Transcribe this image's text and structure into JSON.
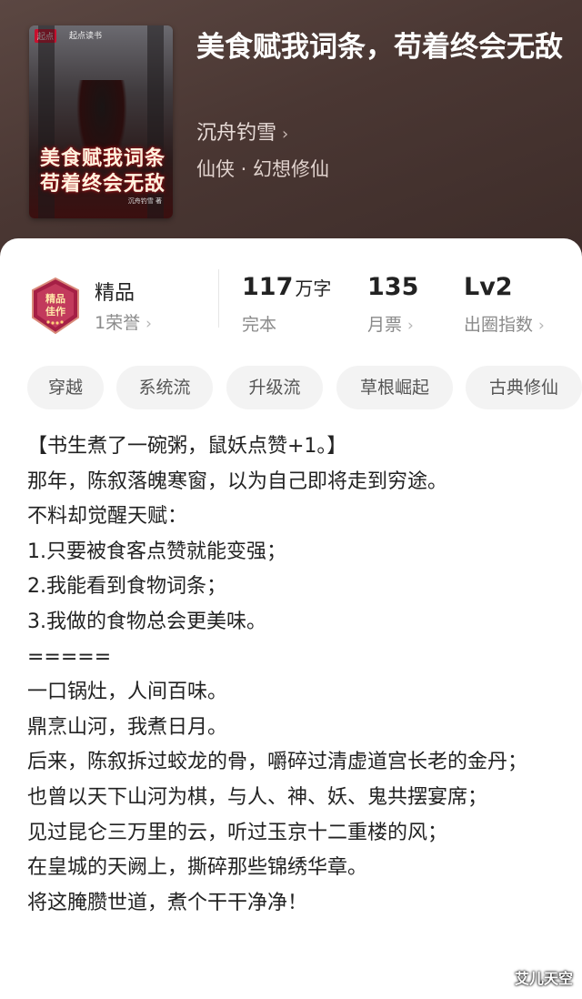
{
  "book": {
    "title": "美食赋我词条，苟着终会无敌",
    "author": "沉舟钓雪",
    "author_chevron": "›",
    "genre": "仙侠 · 幻想修仙",
    "cover": {
      "brand_badge": "起点",
      "brand_text": "起点读书",
      "title_line1": "美食赋我词条",
      "title_line2": "苟着终会无敌",
      "author_mini": "沉舟钓雪 著"
    }
  },
  "stats": {
    "badge_text": "精品",
    "badge_seal": "精品\n佳作",
    "honor": "1荣誉",
    "words_value": "117",
    "words_unit": "万字",
    "words_status": "完本",
    "monthly_value": "135",
    "monthly_label": "月票",
    "level_value": "Lv2",
    "level_label": "出圈指数",
    "chevron": "›"
  },
  "tags": [
    "穿越",
    "系统流",
    "升级流",
    "草根崛起",
    "古典修仙"
  ],
  "description": [
    "【书生煮了一碗粥，鼠妖点赞+1。】",
    "那年，陈叙落魄寒窗，以为自己即将走到穷途。",
    "不料却觉醒天赋：",
    "1.只要被食客点赞就能变强；",
    "2.我能看到食物词条；",
    "3.我做的食物总会更美味。",
    "=====",
    "一口锅灶，人间百味。",
    "鼎烹山河，我煮日月。",
    "后来，陈叙拆过蛟龙的骨，嚼碎过清虚道宫长老的金丹；",
    "也曾以天下山河为棋，与人、神、妖、鬼共摆宴席；",
    "见过昆仑三万里的云，听过玉京十二重楼的风；",
    "在皇城的天阙上，撕碎那些锦绣华章。",
    "将这腌臜世道，煮个干干净净！"
  ],
  "watermark": "艾儿天空",
  "colors": {
    "header_bg": "#4a3733",
    "tag_bg": "#f3f3f3",
    "badge_red": "#b0224a"
  }
}
